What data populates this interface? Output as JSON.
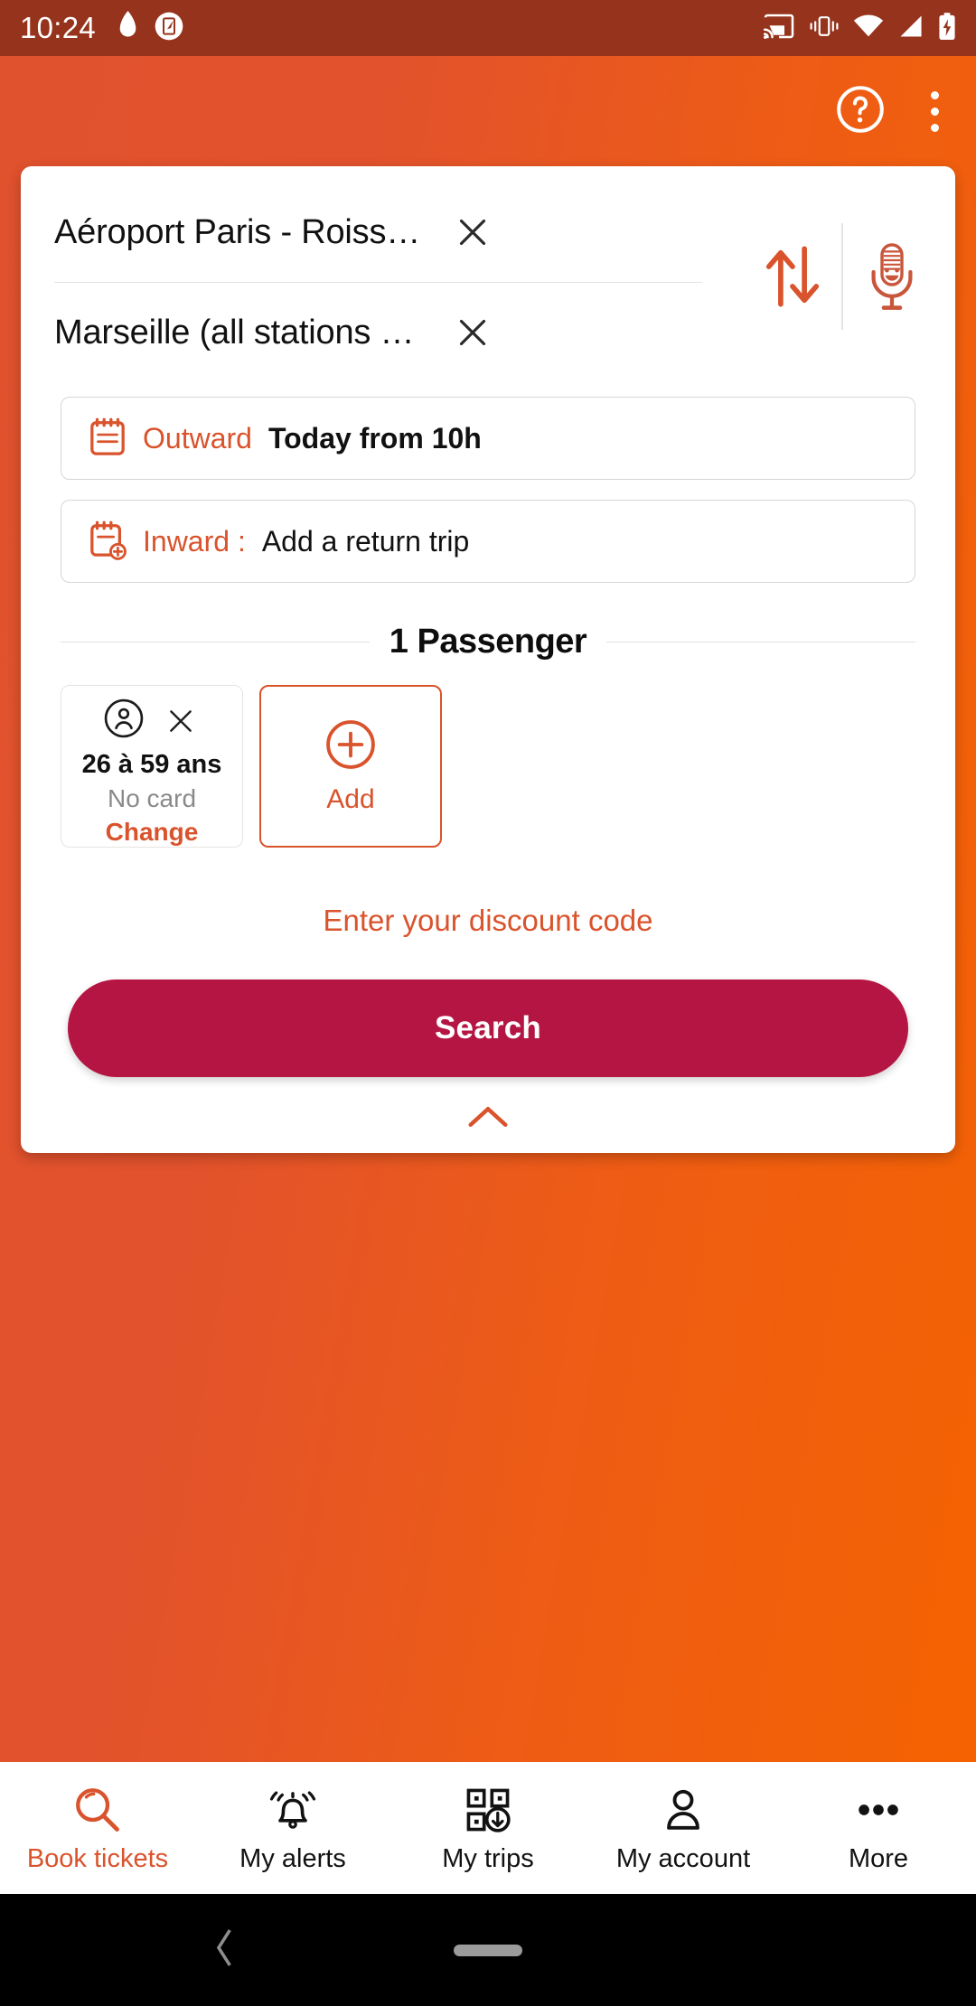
{
  "status_bar": {
    "time": "10:24",
    "left_icons": [
      "flame-icon",
      "note-edit-icon"
    ],
    "right_icons": [
      "cast-icon",
      "vibrate-icon",
      "wifi-icon",
      "signal-icon",
      "battery-charging-icon"
    ]
  },
  "app_bar": {
    "help_icon": "help-circle-icon",
    "overflow_icon": "more-vertical-icon"
  },
  "search_card": {
    "origin": {
      "value": "Aéroport Paris - Roiss…",
      "clear_icon": "close-icon"
    },
    "destination": {
      "value": "Marseille (all stations …",
      "clear_icon": "close-icon"
    },
    "swap_icon": "swap-vertical-icon",
    "mic_icon": "microphone-icon",
    "outward": {
      "label": "Outward",
      "value": "Today from 10h",
      "icon": "calendar-icon"
    },
    "inward": {
      "label": "Inward :",
      "value": "Add a return trip",
      "icon": "calendar-add-icon"
    },
    "passengers": {
      "title": "1 Passenger",
      "items": [
        {
          "avatar_icon": "person-circle-icon",
          "remove_icon": "close-icon",
          "age": "26 à 59 ans",
          "card": "No card",
          "change_label": "Change"
        }
      ],
      "add": {
        "icon": "plus-circle-icon",
        "label": "Add"
      }
    },
    "discount_label": "Enter your discount code",
    "search_label": "Search",
    "collapse_icon": "chevron-up-icon"
  },
  "bottom_nav": {
    "items": [
      {
        "label": "Book tickets",
        "icon": "search-icon",
        "active": true
      },
      {
        "label": "My alerts",
        "icon": "bell-ring-icon",
        "active": false
      },
      {
        "label": "My trips",
        "icon": "qr-download-icon",
        "active": false
      },
      {
        "label": "My account",
        "icon": "person-icon",
        "active": false
      },
      {
        "label": "More",
        "icon": "more-horizontal-icon",
        "active": false
      }
    ]
  },
  "android_nav": {
    "back_icon": "back-chevron-icon",
    "home_pill": "home-pill"
  },
  "colors": {
    "status_bar": "#95331C",
    "background_left": "#E0512E",
    "background_right": "#F56300",
    "accent": "#D9532C",
    "search_button": "#B51543",
    "card": "#FFFFFF"
  }
}
